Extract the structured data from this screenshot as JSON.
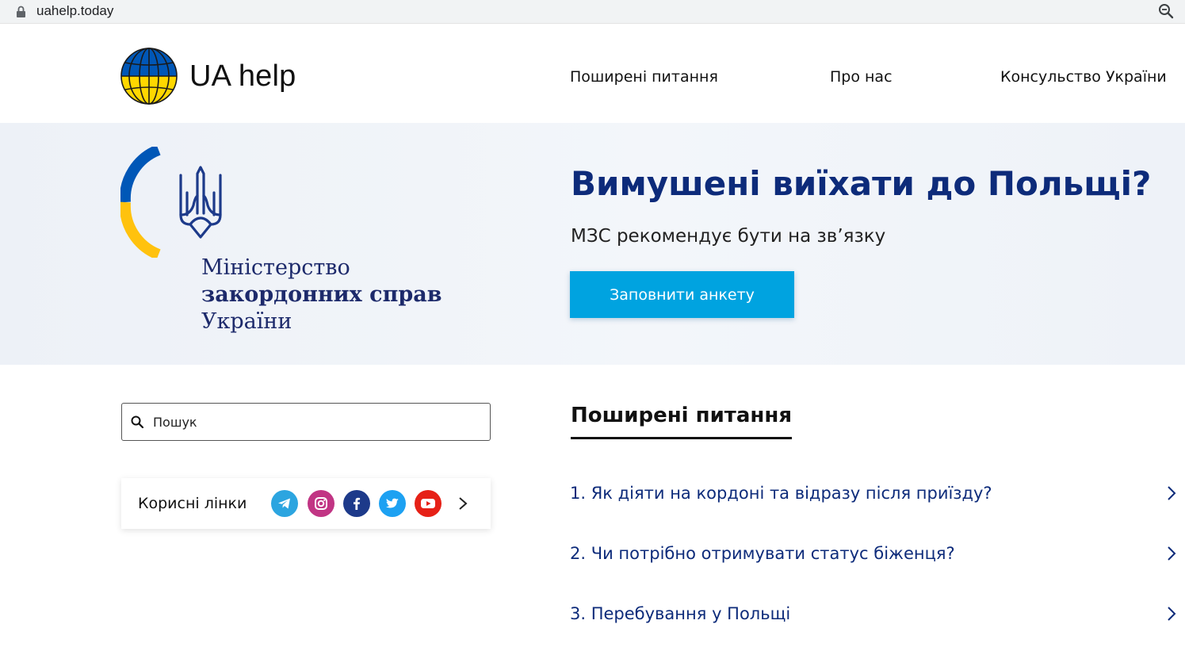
{
  "browser": {
    "url": "uahelp.today",
    "lock_icon": "lock-icon",
    "zoom_icon": "zoom-icon"
  },
  "header": {
    "logo_text": "UA help",
    "nav": [
      {
        "label": "Поширені питання"
      },
      {
        "label": "Про нас"
      },
      {
        "label": "Консульство України"
      }
    ]
  },
  "hero": {
    "ministry_line1": "Міністерство",
    "ministry_line2": "закордонних справ",
    "ministry_line3": "України",
    "title": "Вимушені виїхати до Польщі?",
    "subtitle": "МЗС рекомендує бути на зв’язку",
    "button_label": "Заповнити анкету"
  },
  "search": {
    "placeholder": "Пошук"
  },
  "useful_links": {
    "label": "Корисні лінки",
    "icons": [
      "telegram-icon",
      "instagram-icon",
      "facebook-icon",
      "twitter-icon",
      "youtube-icon"
    ]
  },
  "faq": {
    "heading": "Поширені питання",
    "items": [
      {
        "label": "1. Як діяти на кордоні та відразу після приїзду?"
      },
      {
        "label": "2. Чи потрібно отримувати статус біженця?"
      },
      {
        "label": "3. Перебування у Польщі"
      }
    ]
  },
  "colors": {
    "accent_blue": "#0d2b7a",
    "button_blue": "#00a3e0",
    "flag_blue": "#0057b7",
    "flag_yellow": "#ffd700"
  }
}
